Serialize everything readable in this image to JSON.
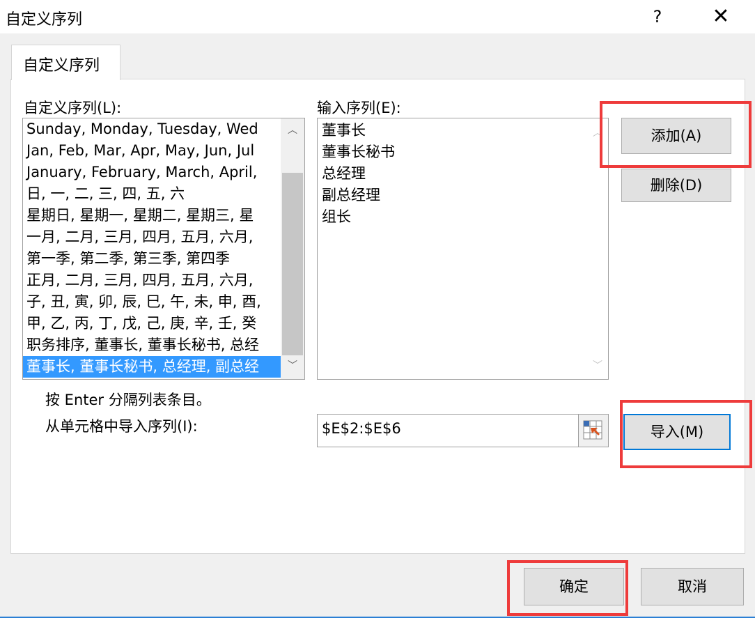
{
  "window": {
    "title": "自定义序列",
    "help_glyph": "?",
    "close_glyph": "✕"
  },
  "tab": {
    "label": "自定义序列"
  },
  "custom_list": {
    "label": "自定义序列(L):",
    "items": [
      "Sunday, Monday, Tuesday, Wed",
      "Jan, Feb, Mar, Apr, May, Jun, Jul",
      "January, February, March, April,",
      "日, 一, 二, 三, 四, 五, 六",
      "星期日, 星期一, 星期二, 星期三, 星",
      "一月, 二月, 三月, 四月, 五月, 六月,",
      "第一季, 第二季, 第三季, 第四季",
      "正月, 二月, 三月, 四月, 五月, 六月,",
      "子, 丑, 寅, 卯, 辰, 巳, 午, 未, 申, 酉,",
      "甲, 乙, 丙, 丁, 戊, 己, 庚, 辛, 壬, 癸",
      "职务排序, 董事长, 董事长秘书, 总经",
      "董事长, 董事长秘书, 总经理, 副总经"
    ],
    "selected_index": 11
  },
  "input_entries": {
    "label": "输入序列(E):",
    "lines": [
      "董事长",
      "董事长秘书",
      "总经理",
      "副总经理",
      "组长"
    ]
  },
  "buttons": {
    "add": "添加(A)",
    "delete": "删除(D)",
    "import": "导入(M)",
    "ok": "确定",
    "cancel": "取消"
  },
  "hint": "按 Enter 分隔列表条目。",
  "import_range": {
    "label": "从单元格中导入序列(I):",
    "value": "$E$2:$E$6"
  },
  "colors": {
    "highlight": "#ee3b3b",
    "selection": "#3399ff",
    "focus_border": "#0078d7",
    "picker_arrow": "#d9531e"
  }
}
